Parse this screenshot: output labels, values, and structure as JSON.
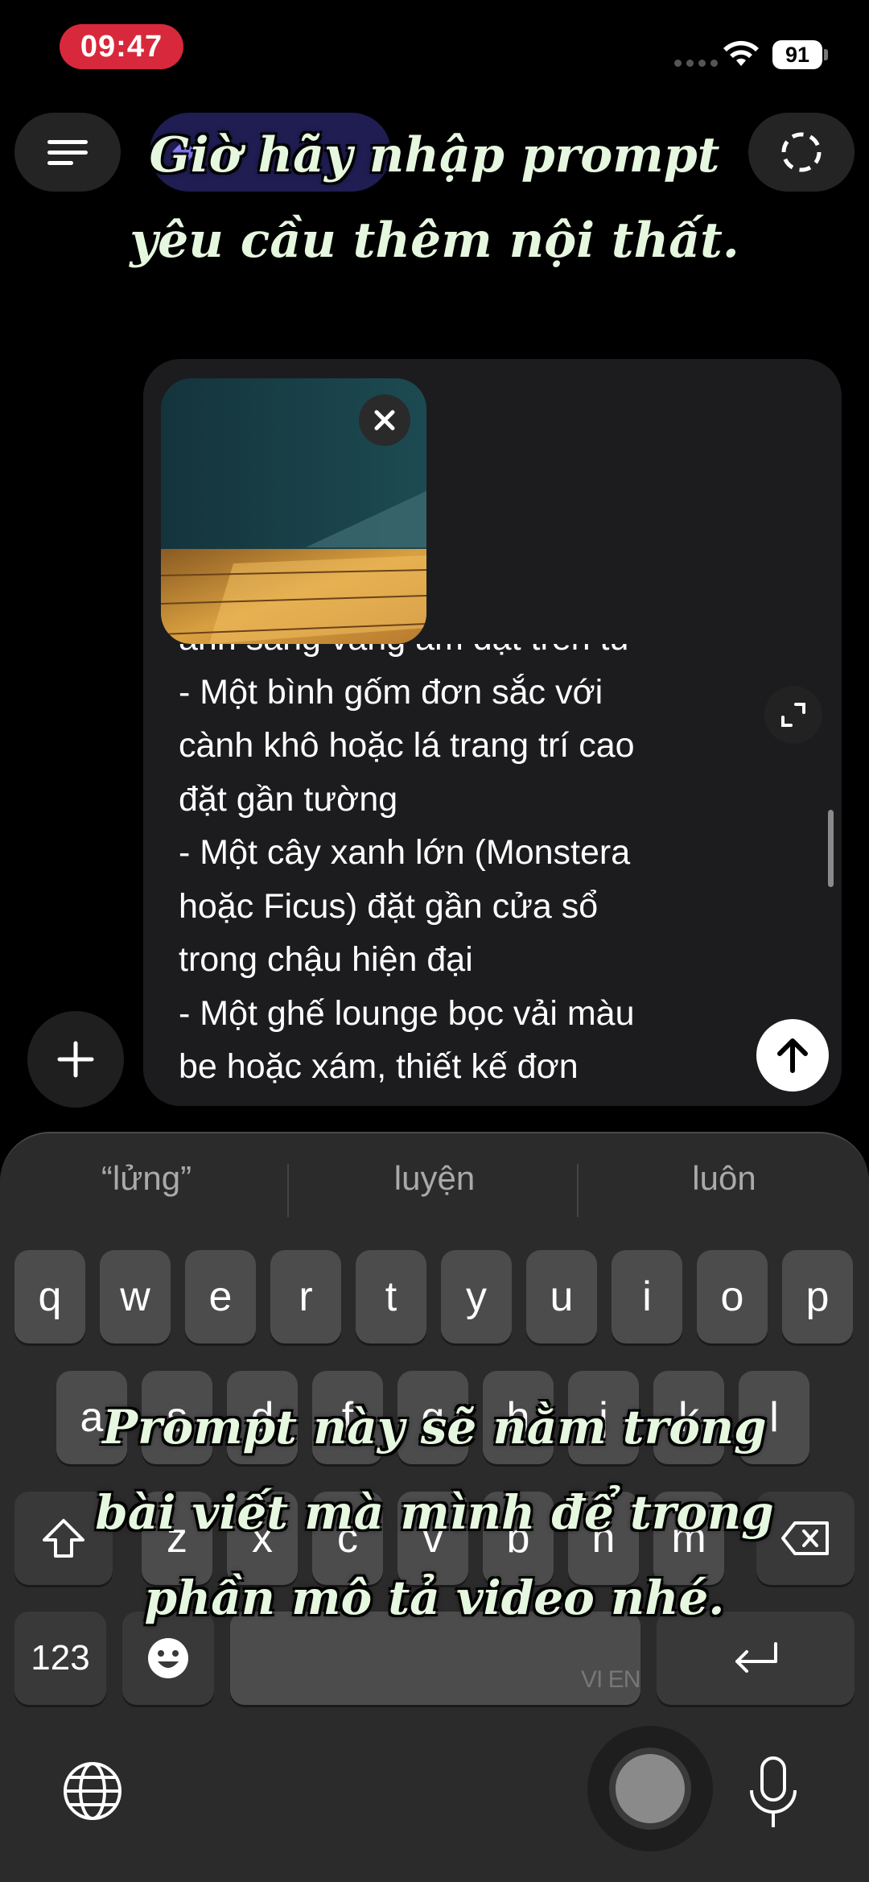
{
  "status": {
    "time": "09:47",
    "battery": "91"
  },
  "captions": {
    "top": [
      "Giờ hãy nhập prompt",
      "yêu cầu thêm nội thất."
    ],
    "bottom": [
      "Prompt này sẽ nằm trong",
      "bài viết mà mình để trong",
      "phần mô tả video nhé."
    ]
  },
  "prompt_lines": [
    "ánh sáng vàng ấm đặt trên tủ",
    "- Một bình gốm đơn sắc với",
    "cành khô hoặc lá trang trí cao",
    "đặt gần tường",
    "- Một cây xanh lớn (Monstera",
    "hoặc Ficus) đặt gần cửa sổ",
    "trong chậu hiện đại",
    "- Một ghế lounge bọc vải màu",
    "be hoặc xám, thiết kế đơn"
  ],
  "keyboard": {
    "suggestions": [
      "“lửng”",
      "luyện",
      "luôn"
    ],
    "row1": [
      "q",
      "w",
      "e",
      "r",
      "t",
      "y",
      "u",
      "i",
      "o",
      "p"
    ],
    "row2": [
      "a",
      "s",
      "d",
      "f",
      "g",
      "h",
      "j",
      "k",
      "l"
    ],
    "row3": [
      "z",
      "x",
      "c",
      "v",
      "b",
      "n",
      "m"
    ],
    "numbers_key": "123",
    "space_lang": "VI EN"
  },
  "icons": [
    "menu-icon",
    "model-diamond-icon",
    "new-chat-icon",
    "close-icon",
    "expand-icon",
    "send-arrow-icon",
    "plus-icon",
    "shift-icon",
    "backspace-icon",
    "emoji-icon",
    "return-icon",
    "globe-icon",
    "microphone-icon"
  ]
}
